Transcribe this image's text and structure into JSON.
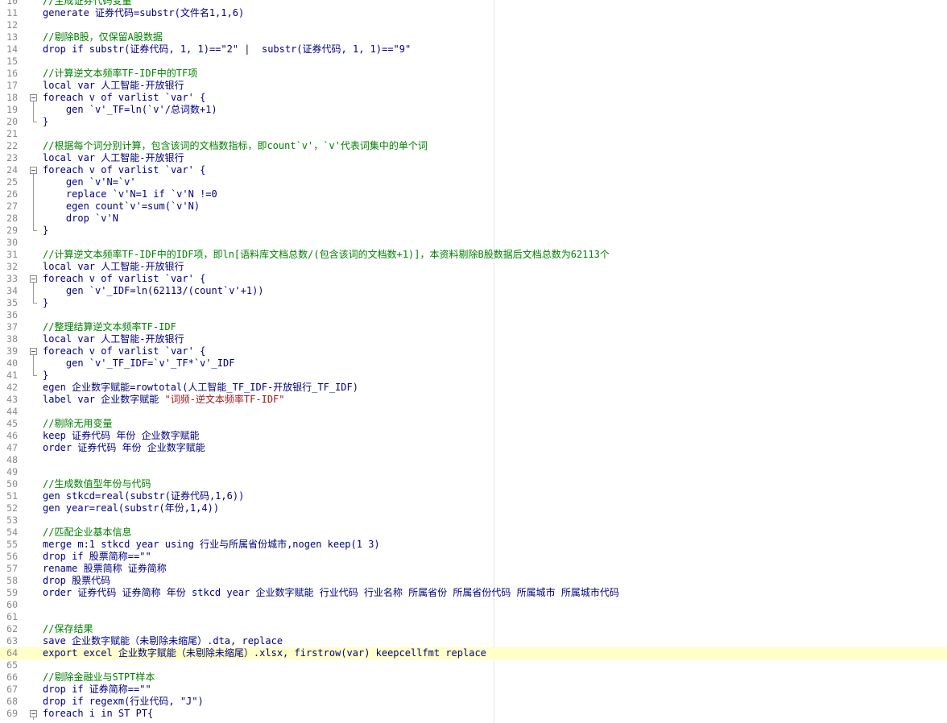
{
  "editor": {
    "current_line": 63,
    "lines": [
      {
        "n": 10,
        "text": "//生成证券代码变量",
        "comment": true
      },
      {
        "n": 11,
        "text": "generate 证券代码=substr(文件名1,1,6)"
      },
      {
        "n": 12,
        "text": ""
      },
      {
        "n": 13,
        "text": "//剔除B股，仅保留A股数据",
        "comment": true
      },
      {
        "n": 14,
        "text": "drop if substr(证券代码, 1, 1)==\"2\" |  substr(证券代码, 1, 1)==\"9\""
      },
      {
        "n": 15,
        "text": ""
      },
      {
        "n": 16,
        "text": "//计算逆文本频率TF-IDF中的TF项",
        "comment": true
      },
      {
        "n": 17,
        "text": "local var 人工智能-开放银行"
      },
      {
        "n": 18,
        "text": "foreach v of varlist `var' {",
        "fold": "open"
      },
      {
        "n": 19,
        "text": "    gen `v'_TF=ln(`v'/总词数+1)",
        "fold": "mid"
      },
      {
        "n": 20,
        "text": "}",
        "fold": "end"
      },
      {
        "n": 21,
        "text": ""
      },
      {
        "n": 22,
        "text": "//根据每个词分别计算，包含该词的文档数指标，即count`v'，`v'代表词集中的单个词",
        "comment": true
      },
      {
        "n": 23,
        "text": "local var 人工智能-开放银行"
      },
      {
        "n": 24,
        "text": "foreach v of varlist `var' {",
        "fold": "open"
      },
      {
        "n": 25,
        "text": "    gen `v'N=`v'",
        "fold": "mid"
      },
      {
        "n": 26,
        "text": "    replace `v'N=1 if `v'N !=0",
        "fold": "mid"
      },
      {
        "n": 27,
        "text": "    egen count`v'=sum(`v'N)",
        "fold": "mid"
      },
      {
        "n": 28,
        "text": "    drop `v'N",
        "fold": "mid"
      },
      {
        "n": 29,
        "text": "}",
        "fold": "end"
      },
      {
        "n": 30,
        "text": ""
      },
      {
        "n": 31,
        "text": "//计算逆文本频率TF-IDF中的IDF项，即ln[语料库文档总数/(包含该词的文档数+1)]，本资料剔除B股数据后文档总数为62113个",
        "comment": true
      },
      {
        "n": 32,
        "text": "local var 人工智能-开放银行"
      },
      {
        "n": 33,
        "text": "foreach v of varlist `var' {",
        "fold": "open"
      },
      {
        "n": 34,
        "text": "    gen `v'_IDF=ln(62113/(count`v'+1))",
        "fold": "mid"
      },
      {
        "n": 35,
        "text": "}",
        "fold": "end"
      },
      {
        "n": 36,
        "text": ""
      },
      {
        "n": 37,
        "text": "//整理结算逆文本频率TF-IDF",
        "comment": true
      },
      {
        "n": 38,
        "text": "local var 人工智能-开放银行"
      },
      {
        "n": 39,
        "text": "foreach v of varlist `var' {",
        "fold": "open"
      },
      {
        "n": 40,
        "text": "    gen `v'_TF_IDF=`v'_TF*`v'_IDF",
        "fold": "mid"
      },
      {
        "n": 41,
        "text": "}",
        "fold": "end"
      },
      {
        "n": 42,
        "text": "egen 企业数字赋能=rowtotal(人工智能_TF_IDF-开放银行_TF_IDF)"
      },
      {
        "n": 43,
        "text": "label var 企业数字赋能 ",
        "string": "\"词频-逆文本频率TF-IDF\""
      },
      {
        "n": 44,
        "text": ""
      },
      {
        "n": 45,
        "text": "//剔除无用变量",
        "comment": true
      },
      {
        "n": 46,
        "text": "keep 证券代码 年份 企业数字赋能"
      },
      {
        "n": 47,
        "text": "order 证券代码 年份 企业数字赋能"
      },
      {
        "n": 48,
        "text": ""
      },
      {
        "n": 49,
        "text": ""
      },
      {
        "n": 50,
        "text": "//生成数值型年份与代码",
        "comment": true
      },
      {
        "n": 51,
        "text": "gen stkcd=real(substr(证券代码,1,6))"
      },
      {
        "n": 52,
        "text": "gen year=real(substr(年份,1,4))"
      },
      {
        "n": 53,
        "text": ""
      },
      {
        "n": 54,
        "text": "//匹配企业基本信息",
        "comment": true
      },
      {
        "n": 55,
        "text": "merge m:1 stkcd year using 行业与所属省份城市,nogen keep(1 3)"
      },
      {
        "n": 56,
        "text": "drop if 股票简称==\"\""
      },
      {
        "n": 57,
        "text": "rename 股票简称 证券简称"
      },
      {
        "n": 58,
        "text": "drop 股票代码"
      },
      {
        "n": 59,
        "text": "order 证券代码 证券简称 年份 stkcd year 企业数字赋能 行业代码 行业名称 所属省份 所属省份代码 所属城市 所属城市代码"
      },
      {
        "n": 60,
        "text": ""
      },
      {
        "n": 61,
        "text": ""
      },
      {
        "n": 62,
        "text": "//保存结果",
        "comment": true
      },
      {
        "n": 63,
        "text": "save 企业数字赋能（未剔除未缩尾）.dta, replace"
      },
      {
        "n": 64,
        "text": "export excel 企业数字赋能（未剔除未缩尾）.xlsx, firstrow(var) keepcellfmt replace"
      },
      {
        "n": 65,
        "text": ""
      },
      {
        "n": 66,
        "text": "//剔除金融业与STPT样本",
        "comment": true
      },
      {
        "n": 67,
        "text": "drop if 证券简称==\"\""
      },
      {
        "n": 68,
        "text": "drop if regexm(行业代码, \"J\")"
      },
      {
        "n": 69,
        "text": "foreach i in ST PT{",
        "fold": "open"
      }
    ]
  }
}
